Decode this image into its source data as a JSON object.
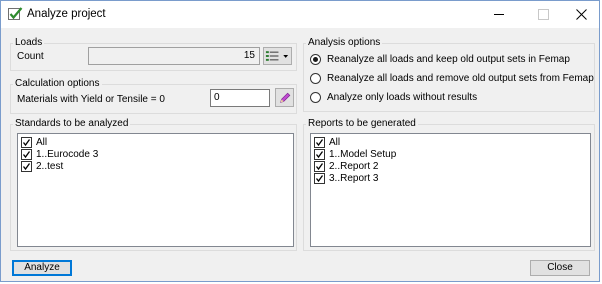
{
  "window": {
    "title": "Analyze project"
  },
  "loads": {
    "group_title": "Loads",
    "count_label": "Count",
    "count_value": "15"
  },
  "calc": {
    "group_title": "Calculation options",
    "materials_label": "Materials with Yield or Tensile = 0",
    "materials_value": "0"
  },
  "analysis": {
    "group_title": "Analysis options",
    "options": [
      {
        "label": "Reanalyze all loads and keep old output sets in Femap",
        "checked": true
      },
      {
        "label": "Reanalyze all loads and remove old output sets from Femap",
        "checked": false
      },
      {
        "label": "Analyze only loads without results",
        "checked": false
      }
    ]
  },
  "standards": {
    "group_title": "Standards to be analyzed",
    "items": [
      {
        "label": "All",
        "checked": true
      },
      {
        "label": "1..Eurocode 3",
        "checked": true
      },
      {
        "label": "2..test",
        "checked": true
      }
    ]
  },
  "reports": {
    "group_title": "Reports to be generated",
    "items": [
      {
        "label": "All",
        "checked": true
      },
      {
        "label": "1..Model Setup",
        "checked": true
      },
      {
        "label": "2..Report 2",
        "checked": true
      },
      {
        "label": "3..Report 3",
        "checked": true
      }
    ]
  },
  "buttons": {
    "analyze": "Analyze",
    "close": "Close"
  },
  "colors": {
    "accent": "#0078d7",
    "check_green": "#2e8b2e"
  },
  "icons": {
    "app": "checkmark-icon",
    "list": "list-icon",
    "edit": "pencil-icon"
  }
}
